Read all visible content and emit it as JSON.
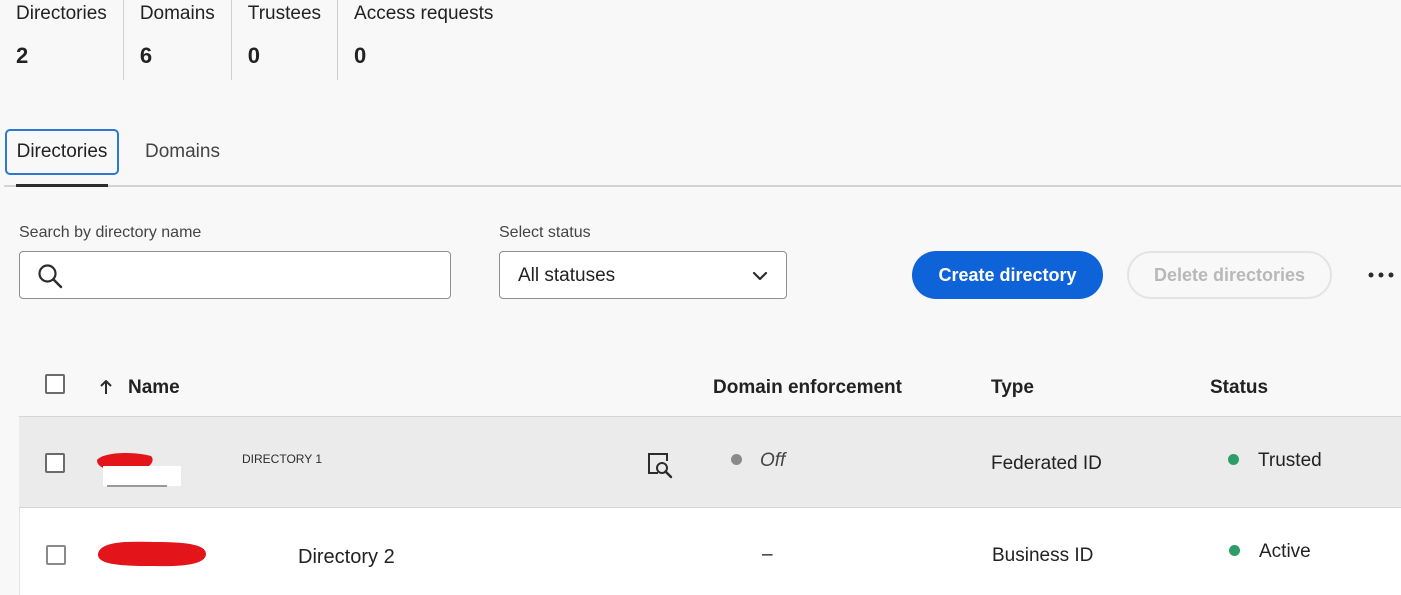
{
  "summary": {
    "stats": [
      {
        "label": "Directories",
        "value": "2"
      },
      {
        "label": "Domains",
        "value": "6"
      },
      {
        "label": "Trustees",
        "value": "0"
      },
      {
        "label": "Access requests",
        "value": "0"
      }
    ]
  },
  "tabs": [
    {
      "label": "Directories",
      "selected": true
    },
    {
      "label": "Domains",
      "selected": false
    }
  ],
  "filters": {
    "search_label": "Search by directory name",
    "search_value": "",
    "search_icon": "search-icon",
    "status_label": "Select status",
    "status_value": "All statuses",
    "status_icon": "chevron-down-icon"
  },
  "actions": {
    "create_label": "Create directory",
    "delete_label": "Delete directories",
    "more_icon": "more-icon",
    "primary_color": "#0f63d8"
  },
  "table": {
    "columns": {
      "name": "Name",
      "domain_enforcement": "Domain enforcement",
      "type": "Type",
      "status": "Status"
    },
    "sort": {
      "column": "Name",
      "direction": "ascending",
      "icon": "arrow-up-icon"
    },
    "rows": [
      {
        "name": "DIRECTORY 1",
        "redacted_name": true,
        "name_icon": "preview-search-icon",
        "domain_enforcement": "Off",
        "domain_enforcement_dot_color": "#8a8a8a",
        "type": "Federated ID",
        "status": "Trusted",
        "status_color": "#2d9d68"
      },
      {
        "name": "Directory 2",
        "redacted_name": true,
        "domain_enforcement": "–",
        "type": "Business ID",
        "status": "Active",
        "status_color": "#2d9d68"
      }
    ]
  }
}
